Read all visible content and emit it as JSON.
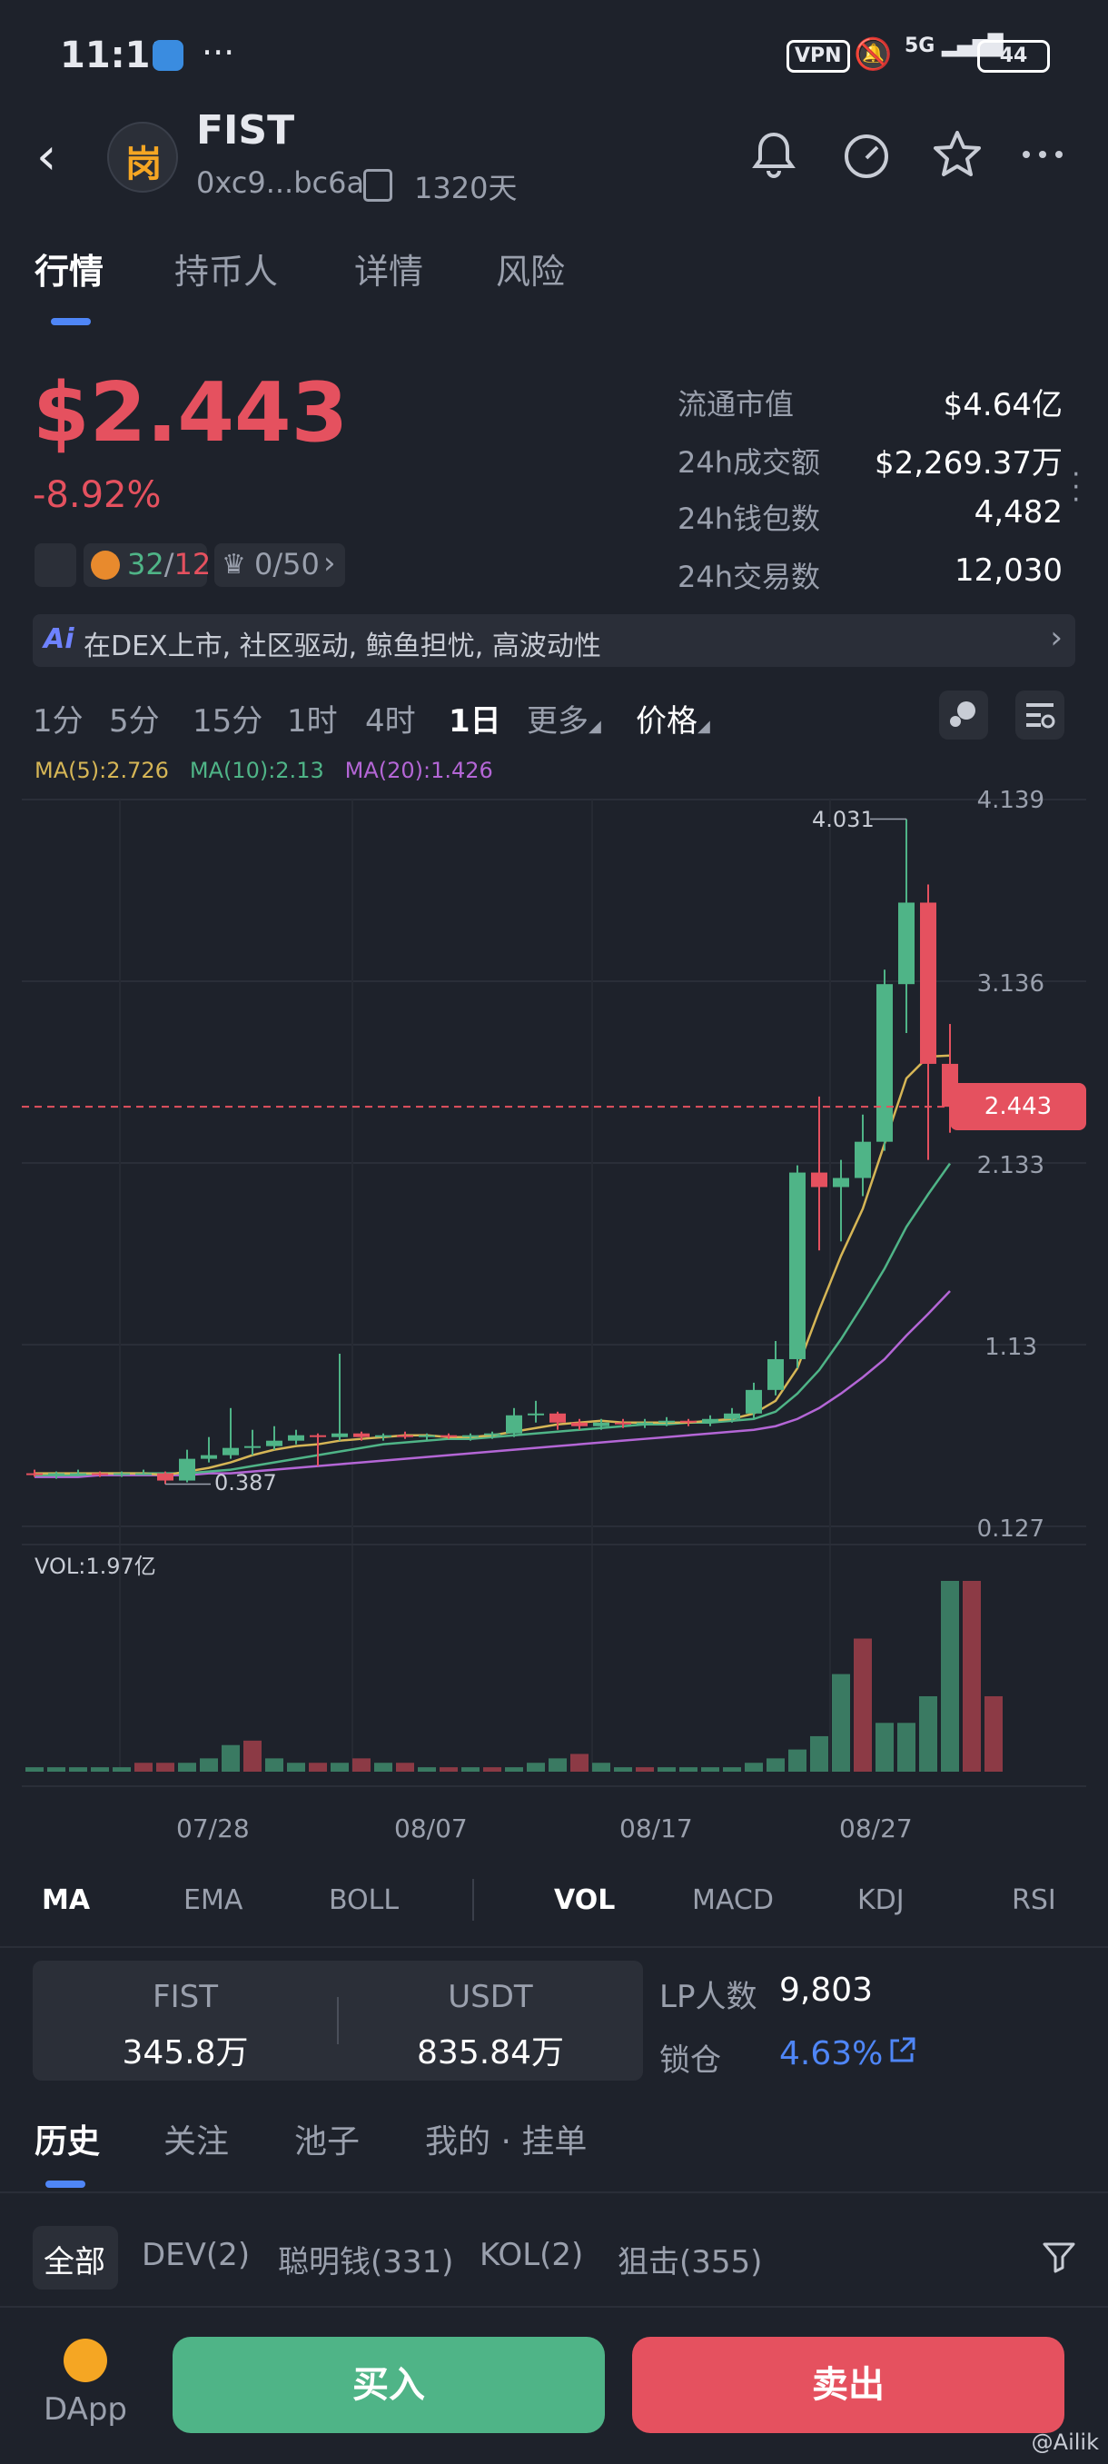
{
  "status_bar": {
    "time": "11:11",
    "dots": "···",
    "vpn": "VPN",
    "network": "5G",
    "battery": "44"
  },
  "header": {
    "token_name": "FIST",
    "address": "0xc9...bc6a",
    "age": "1320天",
    "logo_glyph": "岗"
  },
  "tabs": [
    "行情",
    "持币人",
    "详情",
    "风险"
  ],
  "price": {
    "value": "$2.443",
    "change": "-8.92%",
    "badge2_green": "32",
    "badge2_sep": "/",
    "badge2_red": "12",
    "badge3": "0/50"
  },
  "stats": [
    {
      "label": "流通市值",
      "value": "$4.64亿"
    },
    {
      "label": "24h成交额",
      "value": "$2,269.37万"
    },
    {
      "label": "24h钱包数",
      "value": "4,482"
    },
    {
      "label": "24h交易数",
      "value": "12,030"
    }
  ],
  "ai_bar": {
    "icon": "Ai",
    "text": "在DEX上市, 社区驱动, 鲸鱼担忧, 高波动性"
  },
  "timeframes": [
    "1分",
    "5分",
    "15分",
    "1时",
    "4时",
    "1日",
    "更多",
    "价格"
  ],
  "ma_legend": {
    "ma5": "MA(5):2.726",
    "ma10": "MA(10):2.13",
    "ma20": "MA(20):1.426",
    "ma5_color": "#d6b656",
    "ma10_color": "#4fb487",
    "ma20_color": "#b466d6"
  },
  "chart_data": {
    "type": "candlestick",
    "price_axis_ticks": [
      "4.139",
      "3.136",
      "2.133",
      "1.13",
      "0.127"
    ],
    "current_price_label": "2.443",
    "high_annotation": "4.031",
    "low_annotation": "0.387",
    "volume_label": "VOL:1.97亿",
    "dates": [
      "07/28",
      "08/07",
      "08/17",
      "08/27"
    ],
    "ylim": [
      0.127,
      4.139
    ],
    "up_color": "#4fb487",
    "down_color": "#e5515f",
    "candles": [
      {
        "o": 0.42,
        "h": 0.44,
        "l": 0.4,
        "c": 0.41
      },
      {
        "o": 0.41,
        "h": 0.43,
        "l": 0.39,
        "c": 0.42
      },
      {
        "o": 0.42,
        "h": 0.44,
        "l": 0.41,
        "c": 0.42
      },
      {
        "o": 0.42,
        "h": 0.43,
        "l": 0.4,
        "c": 0.41
      },
      {
        "o": 0.41,
        "h": 0.43,
        "l": 0.4,
        "c": 0.42
      },
      {
        "o": 0.42,
        "h": 0.44,
        "l": 0.41,
        "c": 0.42
      },
      {
        "o": 0.42,
        "h": 0.43,
        "l": 0.36,
        "c": 0.38
      },
      {
        "o": 0.38,
        "h": 0.55,
        "l": 0.37,
        "c": 0.5
      },
      {
        "o": 0.5,
        "h": 0.62,
        "l": 0.48,
        "c": 0.52
      },
      {
        "o": 0.52,
        "h": 0.78,
        "l": 0.5,
        "c": 0.56
      },
      {
        "o": 0.56,
        "h": 0.66,
        "l": 0.52,
        "c": 0.57
      },
      {
        "o": 0.57,
        "h": 0.68,
        "l": 0.55,
        "c": 0.6
      },
      {
        "o": 0.6,
        "h": 0.66,
        "l": 0.58,
        "c": 0.63
      },
      {
        "o": 0.63,
        "h": 0.64,
        "l": 0.46,
        "c": 0.62
      },
      {
        "o": 0.62,
        "h": 1.08,
        "l": 0.6,
        "c": 0.64
      },
      {
        "o": 0.64,
        "h": 0.65,
        "l": 0.6,
        "c": 0.62
      },
      {
        "o": 0.62,
        "h": 0.64,
        "l": 0.6,
        "c": 0.63
      },
      {
        "o": 0.63,
        "h": 0.65,
        "l": 0.61,
        "c": 0.62
      },
      {
        "o": 0.62,
        "h": 0.64,
        "l": 0.6,
        "c": 0.63
      },
      {
        "o": 0.63,
        "h": 0.64,
        "l": 0.61,
        "c": 0.62
      },
      {
        "o": 0.62,
        "h": 0.64,
        "l": 0.6,
        "c": 0.63
      },
      {
        "o": 0.63,
        "h": 0.65,
        "l": 0.61,
        "c": 0.64
      },
      {
        "o": 0.64,
        "h": 0.78,
        "l": 0.62,
        "c": 0.74
      },
      {
        "o": 0.74,
        "h": 0.82,
        "l": 0.7,
        "c": 0.75
      },
      {
        "o": 0.75,
        "h": 0.76,
        "l": 0.66,
        "c": 0.7
      },
      {
        "o": 0.7,
        "h": 0.72,
        "l": 0.66,
        "c": 0.68
      },
      {
        "o": 0.68,
        "h": 0.72,
        "l": 0.66,
        "c": 0.7
      },
      {
        "o": 0.7,
        "h": 0.72,
        "l": 0.67,
        "c": 0.69
      },
      {
        "o": 0.69,
        "h": 0.72,
        "l": 0.67,
        "c": 0.7
      },
      {
        "o": 0.7,
        "h": 0.73,
        "l": 0.68,
        "c": 0.71
      },
      {
        "o": 0.71,
        "h": 0.72,
        "l": 0.68,
        "c": 0.7
      },
      {
        "o": 0.7,
        "h": 0.74,
        "l": 0.68,
        "c": 0.72
      },
      {
        "o": 0.72,
        "h": 0.78,
        "l": 0.7,
        "c": 0.75
      },
      {
        "o": 0.75,
        "h": 0.92,
        "l": 0.72,
        "c": 0.88
      },
      {
        "o": 0.88,
        "h": 1.15,
        "l": 0.85,
        "c": 1.05
      },
      {
        "o": 1.05,
        "h": 2.12,
        "l": 1.0,
        "c": 2.08
      },
      {
        "o": 2.08,
        "h": 2.5,
        "l": 1.65,
        "c": 2.0
      },
      {
        "o": 2.0,
        "h": 2.15,
        "l": 1.7,
        "c": 2.05
      },
      {
        "o": 2.05,
        "h": 2.4,
        "l": 1.95,
        "c": 2.25
      },
      {
        "o": 2.25,
        "h": 3.2,
        "l": 2.2,
        "c": 3.12
      },
      {
        "o": 3.12,
        "h": 4.031,
        "l": 2.85,
        "c": 3.57
      },
      {
        "o": 3.57,
        "h": 3.67,
        "l": 2.15,
        "c": 2.68
      },
      {
        "o": 2.68,
        "h": 2.9,
        "l": 2.3,
        "c": 2.443
      }
    ],
    "ma5": [
      0.42,
      0.42,
      0.42,
      0.42,
      0.42,
      0.42,
      0.41,
      0.43,
      0.45,
      0.48,
      0.52,
      0.55,
      0.57,
      0.58,
      0.6,
      0.61,
      0.62,
      0.63,
      0.63,
      0.62,
      0.62,
      0.63,
      0.65,
      0.67,
      0.69,
      0.7,
      0.71,
      0.7,
      0.7,
      0.7,
      0.7,
      0.71,
      0.72,
      0.75,
      0.82,
      1.0,
      1.32,
      1.62,
      1.88,
      2.24,
      2.6,
      2.72,
      2.726
    ],
    "ma10": [
      0.41,
      0.41,
      0.41,
      0.42,
      0.42,
      0.42,
      0.42,
      0.42,
      0.43,
      0.44,
      0.46,
      0.48,
      0.5,
      0.52,
      0.54,
      0.56,
      0.58,
      0.59,
      0.6,
      0.61,
      0.61,
      0.62,
      0.63,
      0.64,
      0.65,
      0.66,
      0.67,
      0.68,
      0.69,
      0.69,
      0.7,
      0.7,
      0.71,
      0.72,
      0.76,
      0.86,
      0.99,
      1.16,
      1.35,
      1.55,
      1.78,
      1.96,
      2.13
    ],
    "ma20": [
      0.4,
      0.4,
      0.4,
      0.41,
      0.41,
      0.41,
      0.41,
      0.41,
      0.42,
      0.42,
      0.43,
      0.44,
      0.45,
      0.46,
      0.47,
      0.48,
      0.49,
      0.5,
      0.51,
      0.52,
      0.53,
      0.54,
      0.55,
      0.56,
      0.57,
      0.58,
      0.59,
      0.6,
      0.61,
      0.62,
      0.63,
      0.64,
      0.65,
      0.66,
      0.68,
      0.72,
      0.78,
      0.86,
      0.95,
      1.05,
      1.18,
      1.3,
      1.426
    ],
    "volumes": [
      1,
      1,
      1,
      1,
      1,
      2,
      2,
      2,
      3,
      6,
      7,
      3,
      2,
      2,
      2,
      3,
      2,
      2,
      1,
      1,
      1,
      1,
      1,
      2,
      3,
      4,
      2,
      1,
      1,
      1,
      1,
      1,
      1,
      2,
      3,
      5,
      8,
      22,
      30,
      11,
      11,
      17,
      43,
      43,
      17
    ],
    "vol_colors": [
      "g",
      "g",
      "g",
      "g",
      "g",
      "r",
      "r",
      "g",
      "g",
      "g",
      "r",
      "g",
      "g",
      "r",
      "g",
      "r",
      "g",
      "r",
      "g",
      "r",
      "g",
      "r",
      "g",
      "g",
      "g",
      "r",
      "g",
      "g",
      "r",
      "g",
      "g",
      "g",
      "g",
      "g",
      "g",
      "g",
      "g",
      "g",
      "r",
      "g",
      "g",
      "g",
      "g",
      "r",
      "r"
    ]
  },
  "indicators": [
    "MA",
    "EMA",
    "BOLL",
    "VOL",
    "MACD",
    "KDJ",
    "RSI"
  ],
  "pool": {
    "token_a": "FIST",
    "token_a_amount": "345.8万",
    "token_b": "USDT",
    "token_b_amount": "835.84万",
    "lp_label": "LP人数",
    "lp_value": "9,803",
    "lock_label": "锁仓",
    "lock_value": "4.63%"
  },
  "sub_tabs": [
    "历史",
    "关注",
    "池子",
    "我的 · 挂单"
  ],
  "filters": [
    "全部",
    "DEV(2)",
    "聪明钱(331)",
    "KOL(2)",
    "狙击(355)"
  ],
  "bottom": {
    "dapp": "DApp",
    "buy": "买入",
    "sell": "卖出",
    "watermark": "@Ailik"
  }
}
